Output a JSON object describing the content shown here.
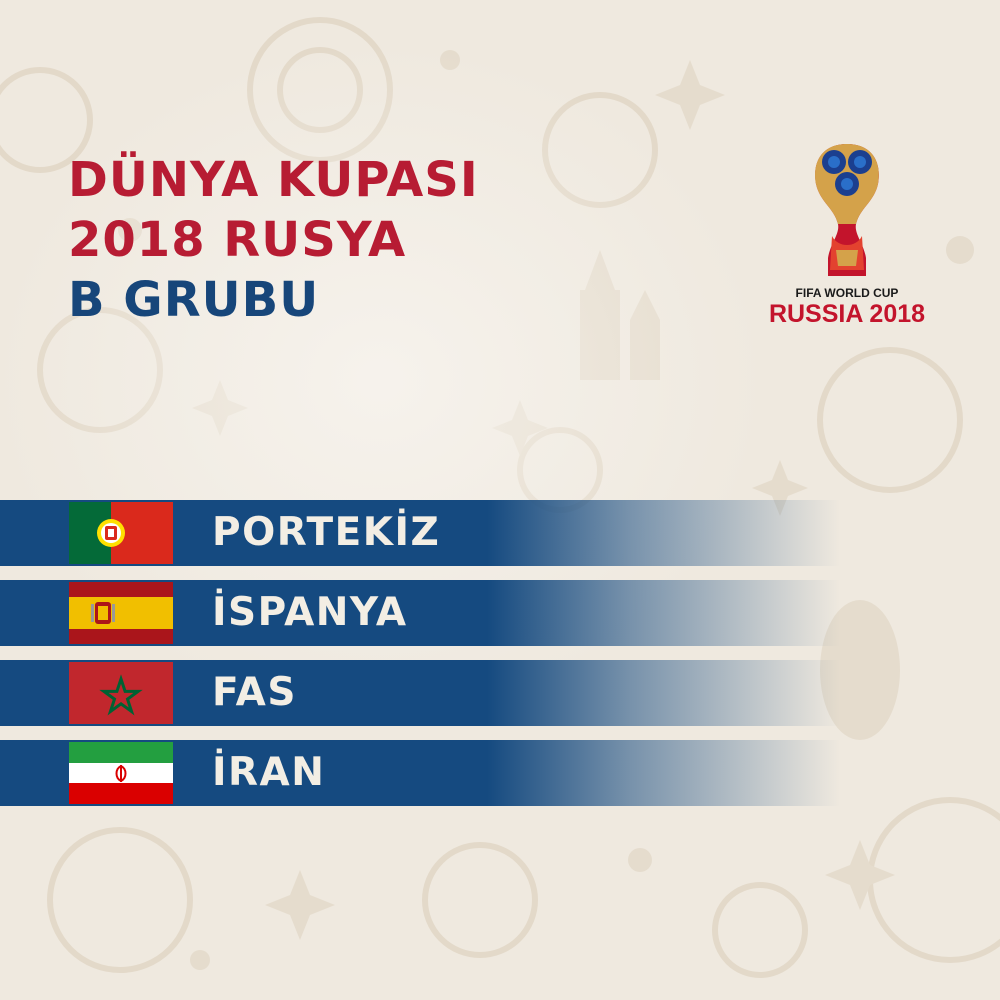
{
  "heading": {
    "line1": "DÜNYA KUPASI",
    "line2": "2018 RUSYA",
    "line3": "B GRUBU"
  },
  "logo": {
    "subtitle": "FIFA WORLD CUP",
    "title": "RUSSIA 2018",
    "icon": "world-cup-trophy-icon"
  },
  "teams": [
    {
      "name": "PORTEKİZ",
      "flag_icon": "portugal-flag-icon"
    },
    {
      "name": "İSPANYA",
      "flag_icon": "spain-flag-icon"
    },
    {
      "name": "FAS",
      "flag_icon": "morocco-flag-icon"
    },
    {
      "name": "İRAN",
      "flag_icon": "iran-flag-icon"
    }
  ],
  "colors": {
    "heading_red": "#b71c33",
    "heading_blue": "#17467a",
    "band_blue": "#154a80",
    "background": "#efe9df",
    "logo_red": "#c3142c"
  }
}
